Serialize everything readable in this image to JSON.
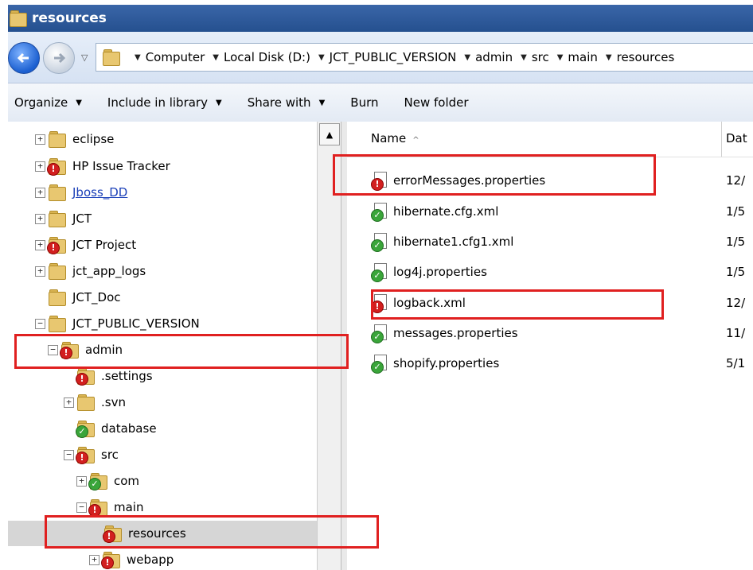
{
  "window": {
    "title": "resources"
  },
  "address": {
    "crumbs": [
      "Computer",
      "Local Disk (D:)",
      "JCT_PUBLIC_VERSION",
      "admin",
      "src",
      "main",
      "resources"
    ]
  },
  "toolbar": {
    "organize": "Organize",
    "include": "Include in library",
    "share": "Share with",
    "burn": "Burn",
    "new_folder": "New folder"
  },
  "tree": {
    "items": [
      {
        "label": "eclipse",
        "expander": "+",
        "overlay": "none",
        "link": false
      },
      {
        "label": "HP Issue Tracker",
        "expander": "+",
        "overlay": "error",
        "link": false
      },
      {
        "label": "Jboss_DD",
        "expander": "+",
        "overlay": "none",
        "link": true
      },
      {
        "label": "JCT",
        "expander": "+",
        "overlay": "none",
        "link": false
      },
      {
        "label": "JCT Project",
        "expander": "+",
        "overlay": "error",
        "link": false
      },
      {
        "label": "jct_app_logs",
        "expander": "+",
        "overlay": "none",
        "link": false
      },
      {
        "label": "JCT_Doc",
        "expander": "",
        "overlay": "none",
        "link": false
      },
      {
        "label": "JCT_PUBLIC_VERSION",
        "expander": "−",
        "overlay": "none",
        "link": false
      },
      {
        "label": "admin",
        "expander": "−",
        "overlay": "error",
        "link": false
      },
      {
        "label": ".settings",
        "expander": "",
        "overlay": "error",
        "link": false
      },
      {
        "label": ".svn",
        "expander": "+",
        "overlay": "none",
        "link": false
      },
      {
        "label": "database",
        "expander": "",
        "overlay": "ok",
        "link": false
      },
      {
        "label": "src",
        "expander": "−",
        "overlay": "error",
        "link": false
      },
      {
        "label": "com",
        "expander": "+",
        "overlay": "ok",
        "link": false
      },
      {
        "label": "main",
        "expander": "−",
        "overlay": "error",
        "link": false
      },
      {
        "label": "resources",
        "expander": "",
        "overlay": "error",
        "link": false
      },
      {
        "label": "webapp",
        "expander": "+",
        "overlay": "error",
        "link": false
      }
    ]
  },
  "files": {
    "header": {
      "name": "Name",
      "date": "Dat"
    },
    "rows": [
      {
        "name": "errorMessages.properties",
        "date": "12/",
        "status": "error"
      },
      {
        "name": "hibernate.cfg.xml",
        "date": "1/5",
        "status": "ok"
      },
      {
        "name": "hibernate1.cfg1.xml",
        "date": "1/5",
        "status": "ok"
      },
      {
        "name": "log4j.properties",
        "date": "1/5",
        "status": "ok"
      },
      {
        "name": "logback.xml",
        "date": "12/",
        "status": "error"
      },
      {
        "name": "messages.properties",
        "date": "11/",
        "status": "ok"
      },
      {
        "name": "shopify.properties",
        "date": "5/1",
        "status": "ok"
      }
    ]
  },
  "colors": {
    "highlight": "#e02020",
    "error_overlay": "#d21f1f",
    "ok_overlay": "#3aa53a",
    "title_bar": "#2f5c9e"
  }
}
